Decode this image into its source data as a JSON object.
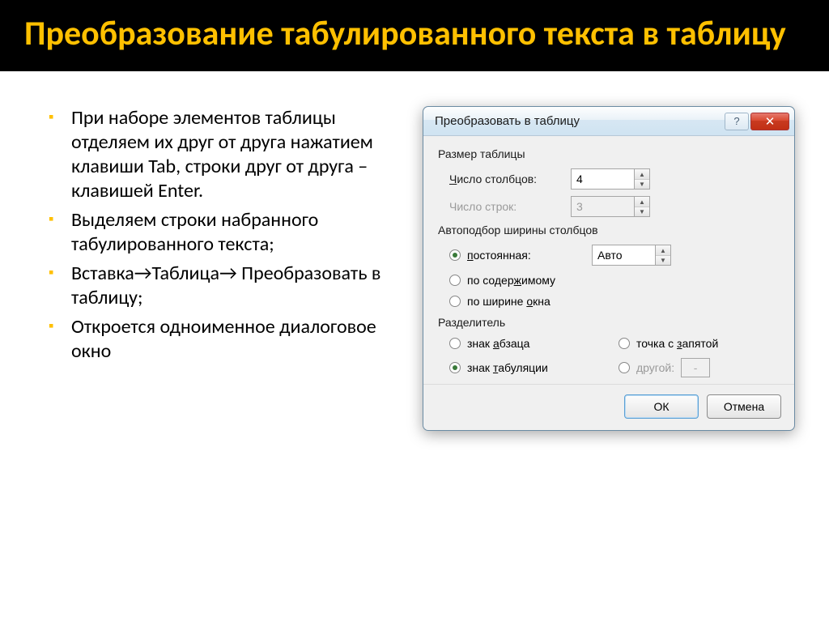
{
  "slide": {
    "title": "Преобразование табулированного текста в таблицу",
    "bullets": [
      "При наборе элементов таблицы отделяем их друг от друга нажатием клавиши Tab, строки друг от друга – клавишей Enter.",
      "Выделяем строки набранного табулированного текста;",
      "Вставка→Таблица→ Преобразовать в таблицу;",
      "Откроется одноименное диалоговое окно"
    ]
  },
  "dialog": {
    "title": "Преобразовать в таблицу",
    "groups": {
      "size": {
        "title": "Размер таблицы",
        "cols_label": "Число столбцов:",
        "cols_value": "4",
        "rows_label": "Число строк:",
        "rows_value": "3"
      },
      "autofit": {
        "title": "Автоподбор ширины столбцов",
        "fixed_label": "постоянная:",
        "fixed_value": "Авто",
        "by_content": "по содержимому",
        "by_window": "по ширине окна"
      },
      "separator": {
        "title": "Разделитель",
        "paragraph": "знак абзаца",
        "tab": "знак табуляции",
        "semicolon": "точка с запятой",
        "other": "другой:",
        "other_value": "-"
      }
    },
    "buttons": {
      "ok": "ОК",
      "cancel": "Отмена"
    }
  }
}
